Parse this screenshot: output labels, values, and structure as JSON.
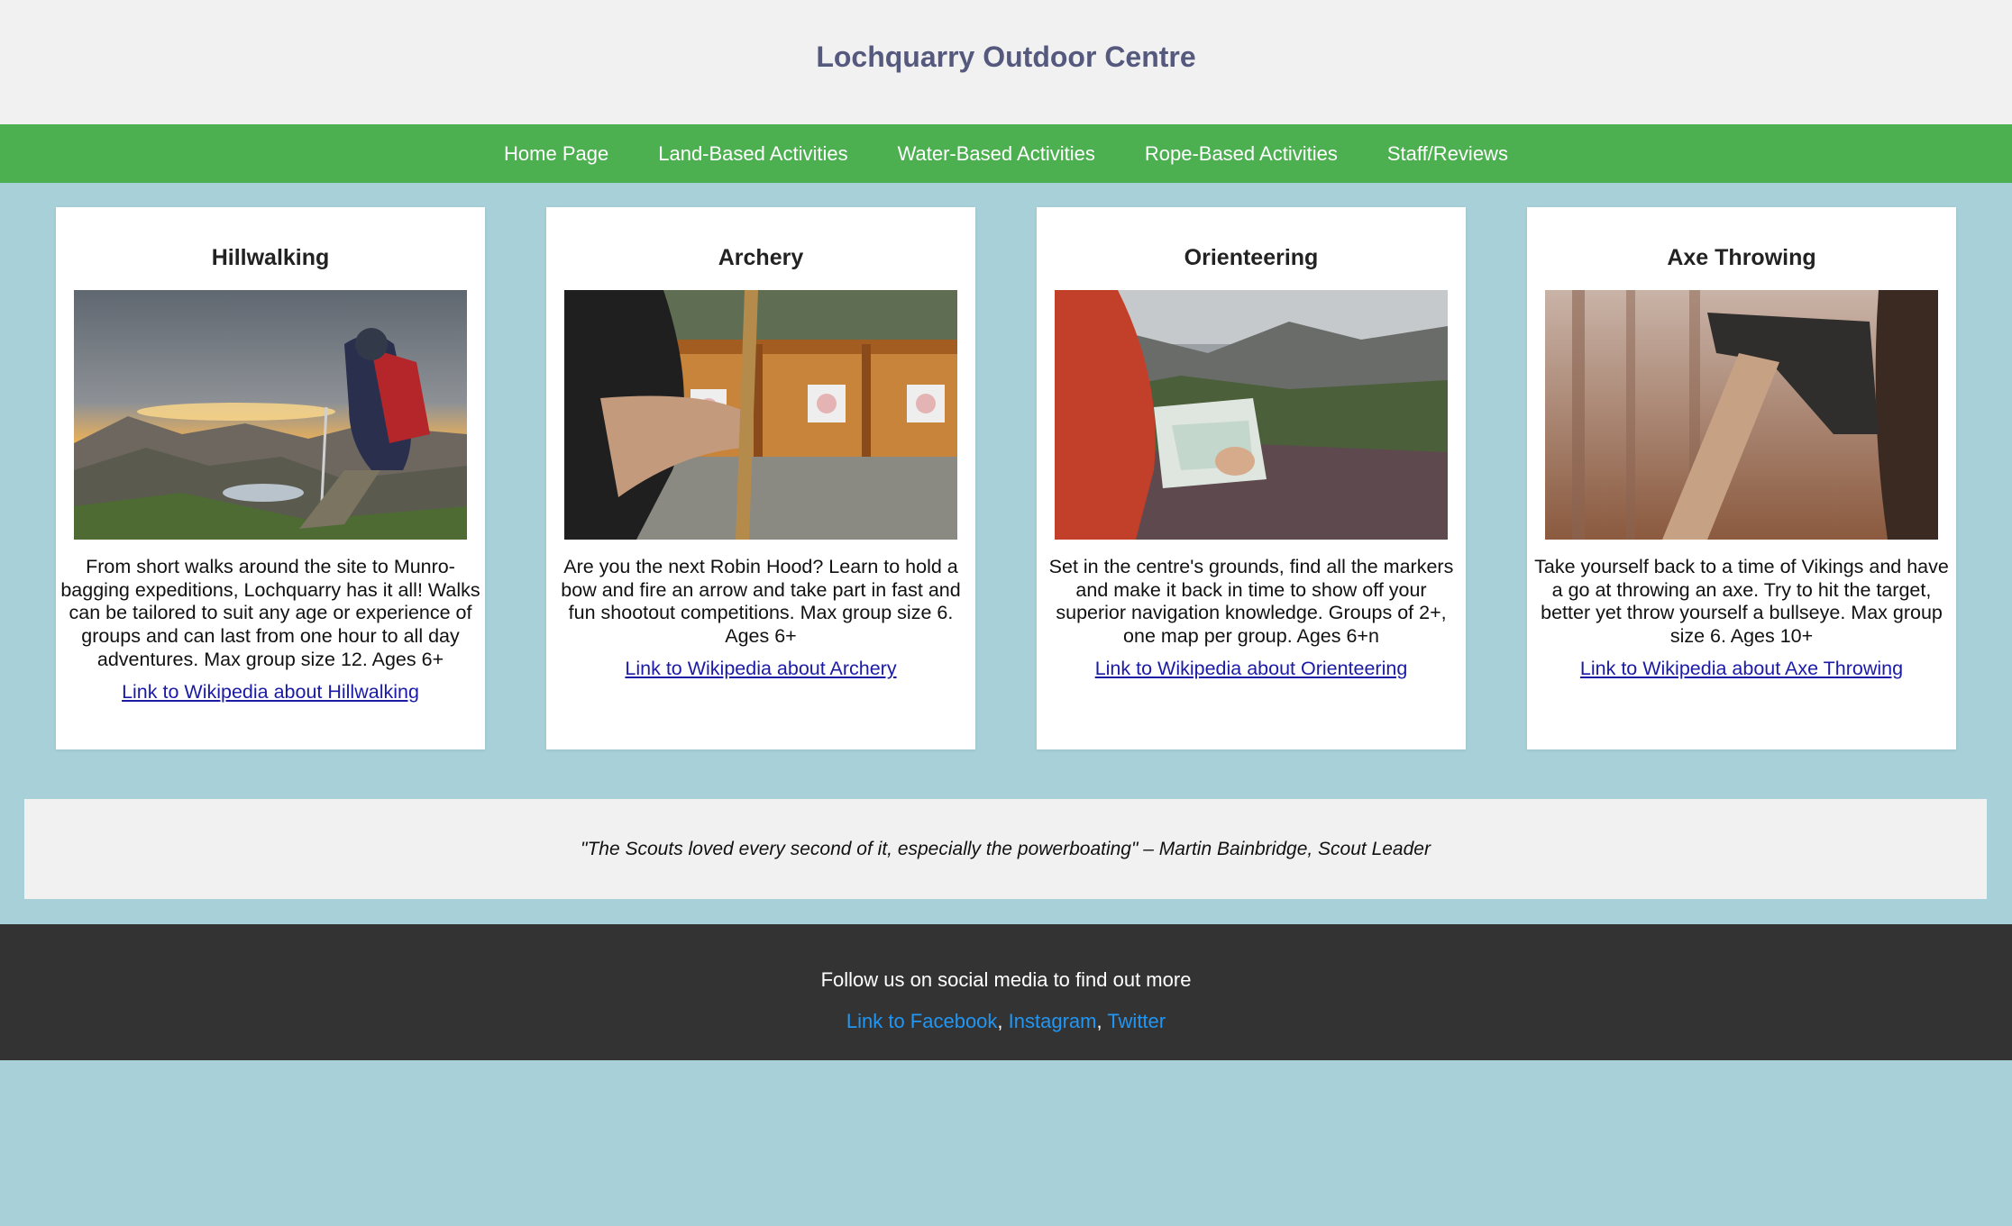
{
  "header": {
    "title": "Lochquarry Outdoor Centre"
  },
  "nav": {
    "items": [
      {
        "label": "Home Page"
      },
      {
        "label": "Land-Based Activities"
      },
      {
        "label": "Water-Based Activities"
      },
      {
        "label": "Rope-Based Activities"
      },
      {
        "label": "Staff/Reviews"
      }
    ]
  },
  "cards": [
    {
      "title": "Hillwalking",
      "description": "From short walks around the site to Munro-bagging expeditions, Lochquarry has it all! Walks can be tailored to suit any age or experience of groups and can last from one hour to all day adventures. Max group size 12. Ages 6+",
      "link": "Link to Wikipedia about Hillwalking"
    },
    {
      "title": "Archery",
      "description": "Are you the next Robin Hood? Learn to hold a bow and fire an arrow and take part in fast and fun shootout competitions. Max group size 6. Ages 6+",
      "link": "Link to Wikipedia about Archery"
    },
    {
      "title": "Orienteering",
      "description": "Set in the centre's grounds, find all the markers and make it back in time to show off your superior navigation knowledge. Groups of 2+, one map per group. Ages 6+n",
      "link": "Link to Wikipedia about Orienteering"
    },
    {
      "title": "Axe Throwing",
      "description": "Take yourself back to a time of Vikings and have a go at throwing an axe. Try to hit the target, better yet throw yourself a bullseye. Max group size 6. Ages 10+",
      "link": "Link to Wikipedia about Axe Throwing"
    }
  ],
  "testimonial": {
    "quote": "\"The Scouts loved every second of it, especially the powerboating\" – Martin Bainbridge, Scout Leader"
  },
  "footer": {
    "follow_text": "Follow us on social media to find out more",
    "facebook": "Link to Facebook",
    "instagram": "Instagram",
    "twitter": "Twitter",
    "separator": ", "
  },
  "colors": {
    "page_background": "#a8d0d8",
    "header_background": "#f1f1f1",
    "title_color": "#55597d",
    "nav_background": "#4caf50",
    "footer_background": "#333333",
    "footer_link": "#2196f3",
    "card_link": "#1a1aa6"
  }
}
